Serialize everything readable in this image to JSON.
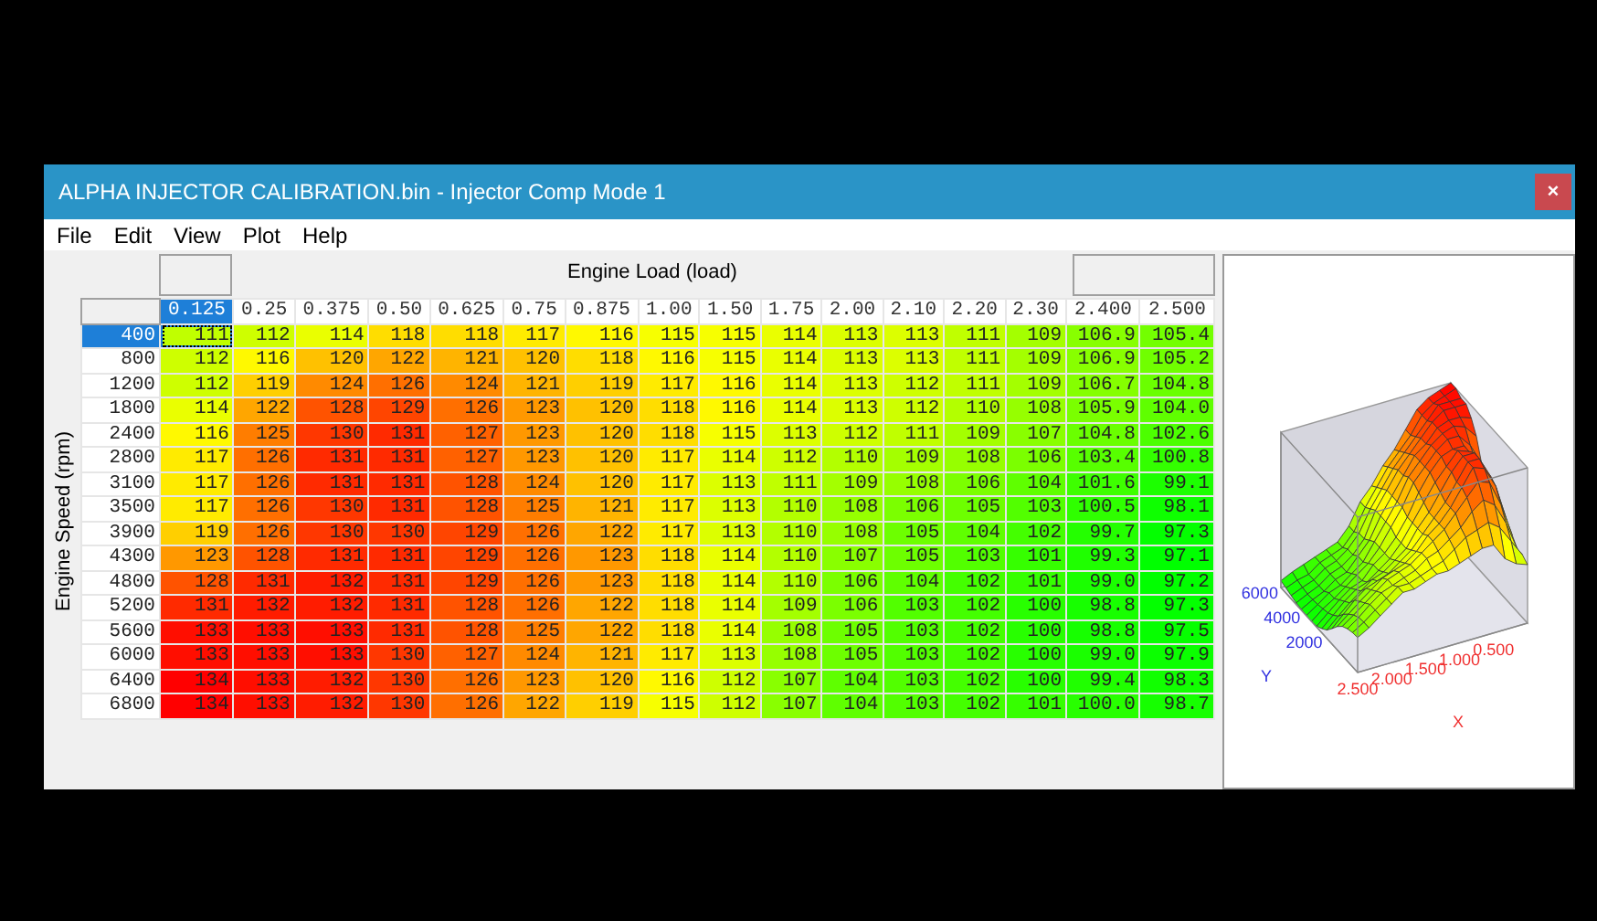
{
  "window": {
    "title": "ALPHA INJECTOR CALIBRATION.bin - Injector Comp Mode 1",
    "close": "×"
  },
  "menu": [
    "File",
    "Edit",
    "View",
    "Plot",
    "Help"
  ],
  "table": {
    "x_axis_title": "Engine Load (load)",
    "y_axis_title": "Engine Speed (rpm)",
    "columns": [
      {
        "label": "0.125",
        "selected": true
      },
      {
        "label": "0.25",
        "selected": false
      },
      {
        "label": "0.375",
        "selected": false
      },
      {
        "label": "0.50",
        "selected": false
      },
      {
        "label": "0.625",
        "selected": false
      },
      {
        "label": "0.75",
        "selected": false
      },
      {
        "label": "0.875",
        "selected": false
      },
      {
        "label": "1.00",
        "selected": false
      },
      {
        "label": "1.50",
        "selected": false
      },
      {
        "label": "1.75",
        "selected": false
      },
      {
        "label": "2.00",
        "selected": false
      },
      {
        "label": "2.10",
        "selected": false
      },
      {
        "label": "2.20",
        "selected": false
      },
      {
        "label": "2.30",
        "selected": false
      },
      {
        "label": "2.400",
        "selected": false
      },
      {
        "label": "2.500",
        "selected": false
      }
    ],
    "rows": [
      {
        "label": "400",
        "selected": true,
        "values": [
          "111",
          "112",
          "114",
          "118",
          "118",
          "117",
          "116",
          "115",
          "115",
          "114",
          "113",
          "113",
          "111",
          "109",
          "106.9",
          "105.4"
        ]
      },
      {
        "label": "800",
        "selected": false,
        "values": [
          "112",
          "116",
          "120",
          "122",
          "121",
          "120",
          "118",
          "116",
          "115",
          "114",
          "113",
          "113",
          "111",
          "109",
          "106.9",
          "105.2"
        ]
      },
      {
        "label": "1200",
        "selected": false,
        "values": [
          "112",
          "119",
          "124",
          "126",
          "124",
          "121",
          "119",
          "117",
          "116",
          "114",
          "113",
          "112",
          "111",
          "109",
          "106.7",
          "104.8"
        ]
      },
      {
        "label": "1800",
        "selected": false,
        "values": [
          "114",
          "122",
          "128",
          "129",
          "126",
          "123",
          "120",
          "118",
          "116",
          "114",
          "113",
          "112",
          "110",
          "108",
          "105.9",
          "104.0"
        ]
      },
      {
        "label": "2400",
        "selected": false,
        "values": [
          "116",
          "125",
          "130",
          "131",
          "127",
          "123",
          "120",
          "118",
          "115",
          "113",
          "112",
          "111",
          "109",
          "107",
          "104.8",
          "102.6"
        ]
      },
      {
        "label": "2800",
        "selected": false,
        "values": [
          "117",
          "126",
          "131",
          "131",
          "127",
          "123",
          "120",
          "117",
          "114",
          "112",
          "110",
          "109",
          "108",
          "106",
          "103.4",
          "100.8"
        ]
      },
      {
        "label": "3100",
        "selected": false,
        "values": [
          "117",
          "126",
          "131",
          "131",
          "128",
          "124",
          "120",
          "117",
          "113",
          "111",
          "109",
          "108",
          "106",
          "104",
          "101.6",
          "99.1"
        ]
      },
      {
        "label": "3500",
        "selected": false,
        "values": [
          "117",
          "126",
          "130",
          "131",
          "128",
          "125",
          "121",
          "117",
          "113",
          "110",
          "108",
          "106",
          "105",
          "103",
          "100.5",
          "98.1"
        ]
      },
      {
        "label": "3900",
        "selected": false,
        "values": [
          "119",
          "126",
          "130",
          "130",
          "129",
          "126",
          "122",
          "117",
          "113",
          "110",
          "108",
          "105",
          "104",
          "102",
          "99.7",
          "97.3"
        ]
      },
      {
        "label": "4300",
        "selected": false,
        "values": [
          "123",
          "128",
          "131",
          "131",
          "129",
          "126",
          "123",
          "118",
          "114",
          "110",
          "107",
          "105",
          "103",
          "101",
          "99.3",
          "97.1"
        ]
      },
      {
        "label": "4800",
        "selected": false,
        "values": [
          "128",
          "131",
          "132",
          "131",
          "129",
          "126",
          "123",
          "118",
          "114",
          "110",
          "106",
          "104",
          "102",
          "101",
          "99.0",
          "97.2"
        ]
      },
      {
        "label": "5200",
        "selected": false,
        "values": [
          "131",
          "132",
          "132",
          "131",
          "128",
          "126",
          "122",
          "118",
          "114",
          "109",
          "106",
          "103",
          "102",
          "100",
          "98.8",
          "97.3"
        ]
      },
      {
        "label": "5600",
        "selected": false,
        "values": [
          "133",
          "133",
          "133",
          "131",
          "128",
          "125",
          "122",
          "118",
          "114",
          "108",
          "105",
          "103",
          "102",
          "100",
          "98.8",
          "97.5"
        ]
      },
      {
        "label": "6000",
        "selected": false,
        "values": [
          "133",
          "133",
          "133",
          "130",
          "127",
          "124",
          "121",
          "117",
          "113",
          "108",
          "105",
          "103",
          "102",
          "100",
          "99.0",
          "97.9"
        ]
      },
      {
        "label": "6400",
        "selected": false,
        "values": [
          "134",
          "133",
          "132",
          "130",
          "126",
          "123",
          "120",
          "116",
          "112",
          "107",
          "104",
          "103",
          "102",
          "100",
          "99.4",
          "98.3"
        ]
      },
      {
        "label": "6800",
        "selected": false,
        "values": [
          "134",
          "133",
          "132",
          "130",
          "126",
          "122",
          "119",
          "115",
          "112",
          "107",
          "104",
          "103",
          "102",
          "101",
          "100.0",
          "98.7"
        ]
      }
    ]
  },
  "plot": {
    "y_ticks": [
      "2000",
      "4000",
      "6000"
    ],
    "y_label": "Y",
    "x_ticks": [
      "2.500",
      "2.000",
      "1.500",
      "1.000",
      "0.500"
    ],
    "x_label": "X"
  }
}
